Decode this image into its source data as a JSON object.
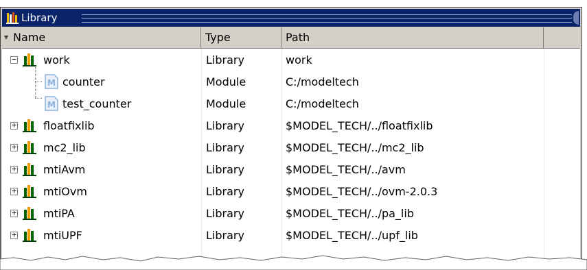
{
  "window": {
    "title": "Library",
    "title_icon": "library-icon"
  },
  "columns": {
    "name": "Name",
    "type": "Type",
    "path": "Path"
  },
  "rows": [
    {
      "name": "work",
      "type": "Library",
      "path": "work",
      "kind": "library",
      "expander": "−",
      "level": 0
    },
    {
      "name": "counter",
      "type": "Module",
      "path": "C:/modeltech",
      "kind": "module",
      "level": 1
    },
    {
      "name": "test_counter",
      "type": "Module",
      "path": "C:/modeltech",
      "kind": "module",
      "level": 1
    },
    {
      "name": "floatfixlib",
      "type": "Library",
      "path": "$MODEL_TECH/../floatfixlib",
      "kind": "library",
      "expander": "+",
      "level": 0
    },
    {
      "name": "mc2_lib",
      "type": "Library",
      "path": "$MODEL_TECH/../mc2_lib",
      "kind": "library",
      "expander": "+",
      "level": 0
    },
    {
      "name": "mtiAvm",
      "type": "Library",
      "path": "$MODEL_TECH/../avm",
      "kind": "library",
      "expander": "+",
      "level": 0
    },
    {
      "name": "mtiOvm",
      "type": "Library",
      "path": "$MODEL_TECH/../ovm-2.0.3",
      "kind": "library",
      "expander": "+",
      "level": 0
    },
    {
      "name": "mtiPA",
      "type": "Library",
      "path": "$MODEL_TECH/../pa_lib",
      "kind": "library",
      "expander": "+",
      "level": 0
    },
    {
      "name": "mtiUPF",
      "type": "Library",
      "path": "$MODEL_TECH/../upf_lib",
      "kind": "library",
      "expander": "+",
      "level": 0
    }
  ],
  "colors": {
    "title_bar": "#0a246a",
    "library_icon": "#006400",
    "module_icon": "#8fb0d8"
  }
}
